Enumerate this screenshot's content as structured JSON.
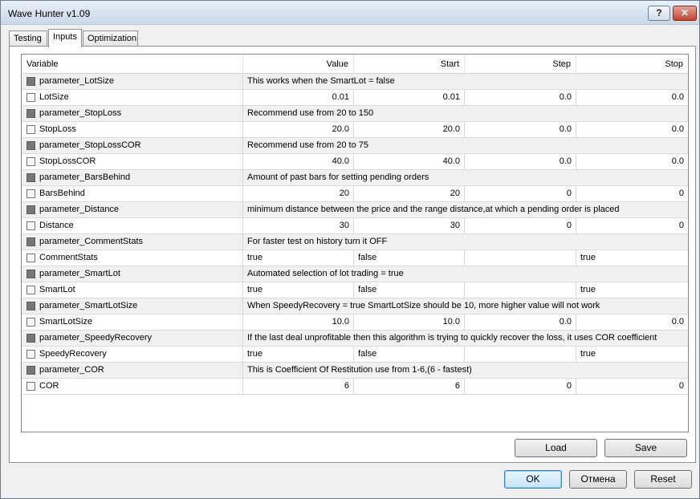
{
  "window": {
    "title": "Wave Hunter v1.09",
    "help_label": "?",
    "close_label": "✕"
  },
  "tabs": [
    {
      "label": "Testing"
    },
    {
      "label": "Inputs"
    },
    {
      "label": "Optimization"
    }
  ],
  "grid": {
    "columns": [
      "Variable",
      "Value",
      "Start",
      "Step",
      "Stop"
    ],
    "rows": [
      {
        "name": "parameter_LotSize",
        "desc": "This works when the SmartLot = false"
      },
      {
        "name": "LotSize",
        "value": "0.01",
        "start": "0.01",
        "step": "0.0",
        "stop": "0.0"
      },
      {
        "name": "parameter_StopLoss",
        "desc": "Recommend use from 20 to 150"
      },
      {
        "name": "StopLoss",
        "value": "20.0",
        "start": "20.0",
        "step": "0.0",
        "stop": "0.0"
      },
      {
        "name": "parameter_StopLossCOR",
        "desc": "Recommend use from 20 to 75"
      },
      {
        "name": "StopLossCOR",
        "value": "40.0",
        "start": "40.0",
        "step": "0.0",
        "stop": "0.0"
      },
      {
        "name": "parameter_BarsBehind",
        "desc": "Amount of past bars for setting pending orders"
      },
      {
        "name": "BarsBehind",
        "value": "20",
        "start": "20",
        "step": "0",
        "stop": "0"
      },
      {
        "name": "parameter_Distance",
        "desc": "minimum distance between the price and the range distance,at which a pending order is placed"
      },
      {
        "name": "Distance",
        "value": "30",
        "start": "30",
        "step": "0",
        "stop": "0"
      },
      {
        "name": "parameter_CommentStats",
        "desc": "For faster test on history turn it OFF"
      },
      {
        "name": "CommentStats",
        "value": "true",
        "start": "false",
        "step": "",
        "stop": "true",
        "bool": true
      },
      {
        "name": "parameter_SmartLot",
        "desc": "Automated selection of  lot trading = true"
      },
      {
        "name": "SmartLot",
        "value": "true",
        "start": "false",
        "step": "",
        "stop": "true",
        "bool": true
      },
      {
        "name": "parameter_SmartLotSize",
        "desc": "When SpeedyRecovery = true SmartLotSize should be 10, more higher value will not work"
      },
      {
        "name": "SmartLotSize",
        "value": "10.0",
        "start": "10.0",
        "step": "0.0",
        "stop": "0.0"
      },
      {
        "name": "parameter_SpeedyRecovery",
        "desc": "If the last deal unprofitable then this algorithm is trying to quickly recover the loss, it uses COR coefficient"
      },
      {
        "name": "SpeedyRecovery",
        "value": "true",
        "start": "false",
        "step": "",
        "stop": "true",
        "bool": true
      },
      {
        "name": "parameter_COR",
        "desc": "This is Coefficient Of Restitution use from 1-6,(6 - fastest)"
      },
      {
        "name": "COR",
        "value": "6",
        "start": "6",
        "step": "0",
        "stop": "0"
      }
    ]
  },
  "panel_buttons": {
    "load": "Load",
    "save": "Save"
  },
  "dialog_buttons": {
    "ok": "OK",
    "cancel": "Отмена",
    "reset": "Reset"
  }
}
